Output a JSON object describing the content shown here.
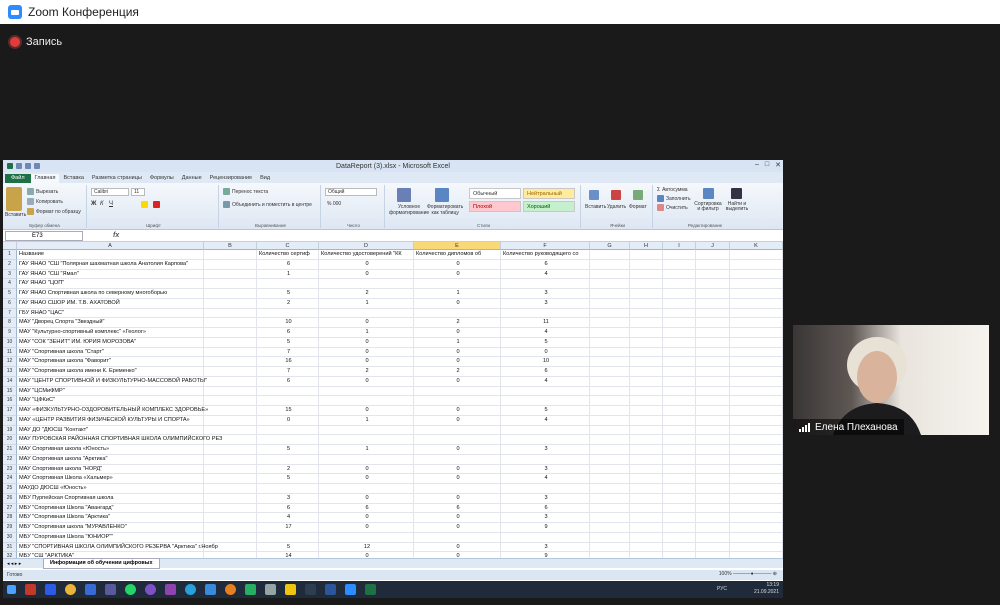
{
  "zoom": {
    "title": "Zoom Конференция",
    "recording": "Запись",
    "colors": {
      "recording": "#e23b3b",
      "brand": "#2D8CFF"
    }
  },
  "excel": {
    "title": "DataReport (3).xlsx - Microsoft Excel",
    "tabs": [
      "Файл",
      "Главная",
      "Вставка",
      "Разметка страницы",
      "Формулы",
      "Данные",
      "Рецензирование",
      "Вид"
    ],
    "ribbon": {
      "clipboard": {
        "paste": "Вставить",
        "cut": "Вырезать",
        "copy": "Копировать",
        "format_painter": "Формат по образцу",
        "caption": "Буфер обмена"
      },
      "font": {
        "name": "Calibri",
        "size": "11",
        "caption": "Шрифт"
      },
      "alignment": {
        "wrap": "Перенос текста",
        "merge": "Объединить и поместить в центре",
        "caption": "Выравнивание"
      },
      "number": {
        "format": "Общий",
        "caption": "Число"
      },
      "styles": {
        "conditional": "Условное форматирование",
        "as_table": "Форматировать как таблицу",
        "normal": "Обычный",
        "neutral": "Нейтральный",
        "bad": "Плохой",
        "good": "Хороший",
        "caption": "Стили"
      },
      "cells": {
        "insert": "Вставить",
        "delete": "Удалить",
        "format": "Формат",
        "caption": "Ячейки"
      },
      "editing": {
        "autosum": "Автосумма",
        "fill": "Заполнить",
        "clear": "Очистить",
        "sort": "Сортировка и фильтр",
        "find": "Найти и выделить",
        "caption": "Редактирование"
      }
    },
    "name_box": "E73",
    "fx": "fx",
    "columns": [
      "A",
      "B",
      "C",
      "D",
      "E",
      "F",
      "G",
      "H",
      "I",
      "J",
      "K"
    ],
    "rows": [
      {
        "n": "1",
        "a": "Название",
        "c": "Количество сертиф",
        "d": "Количество удостоверений \"КК",
        "e": "Количество дипломов об",
        "f": "Количество руководящего со"
      },
      {
        "n": "2",
        "a": "ГАУ ЯНАО \"СШ \"Полярная шахматная школа Анатолия Карпова\"",
        "c": "6",
        "d": "0",
        "e": "0",
        "f": "6"
      },
      {
        "n": "3",
        "a": "ГАУ ЯНАО \"СШ \"Ямал\"",
        "c": "1",
        "d": "0",
        "e": "0",
        "f": "4"
      },
      {
        "n": "4",
        "a": "ГАУ ЯНАО \"ЦОП\"",
        "c": "",
        "d": "",
        "e": "",
        "f": ""
      },
      {
        "n": "5",
        "a": "ГАУ ЯНАО Спортивная школа по северному многоборью",
        "c": "5",
        "d": "2",
        "e": "1",
        "f": "3"
      },
      {
        "n": "6",
        "a": "ГАУ ЯНАО СШОР ИМ. Т.В. АХАТОВОЙ",
        "c": "2",
        "d": "1",
        "e": "0",
        "f": "3"
      },
      {
        "n": "7",
        "a": "ГБУ ЯНАО \"ЦАС\"",
        "c": "",
        "d": "",
        "e": "",
        "f": ""
      },
      {
        "n": "8",
        "a": "МАУ \"Дворец Спорта \"Звездный\"",
        "c": "10",
        "d": "0",
        "e": "2",
        "f": "11"
      },
      {
        "n": "9",
        "a": "МАУ \"Культурно-спортивный комплекс\" «Геолог»",
        "c": "6",
        "d": "1",
        "e": "0",
        "f": "4"
      },
      {
        "n": "10",
        "a": "МАУ \"СОК \"ЗЕНИТ\" ИМ. ЮРИЯ МОРОЗОВА\"",
        "c": "5",
        "d": "0",
        "e": "1",
        "f": "5"
      },
      {
        "n": "11",
        "a": "МАУ \"Спортивная школа \"Старт\"",
        "c": "7",
        "d": "0",
        "e": "0",
        "f": "0"
      },
      {
        "n": "12",
        "a": "МАУ \"Спортивная школа \"Фаворит\"",
        "c": "16",
        "d": "0",
        "e": "0",
        "f": "10"
      },
      {
        "n": "13",
        "a": "МАУ \"Спортивная школа имени К. Еременко\"",
        "c": "7",
        "d": "2",
        "e": "2",
        "f": "6"
      },
      {
        "n": "14",
        "a": "МАУ \"ЦЕНТР СПОРТИВНОЙ И ФИЗКУЛЬТУРНО-МАССОВОЙ РАБОТЫ\"",
        "c": "6",
        "d": "0",
        "e": "0",
        "f": "4"
      },
      {
        "n": "15",
        "a": "МАУ \"ЦСМиФМР\"",
        "c": "",
        "d": "",
        "e": "",
        "f": ""
      },
      {
        "n": "16",
        "a": "МАУ \"ЦФКиС\"",
        "c": "",
        "d": "",
        "e": "",
        "f": ""
      },
      {
        "n": "17",
        "a": "МАУ «ФИЗКУЛЬТУРНО-ОЗДОРОВИТЕЛЬНЫЙ КОМПЛЕКС ЗДОРОВЬЕ»",
        "c": "15",
        "d": "0",
        "e": "0",
        "f": "5"
      },
      {
        "n": "18",
        "a": "МАУ «ЦЕНТР РАЗВИТИЯ ФИЗИЧЕСКОЙ КУЛЬТУРЫ И СПОРТА»",
        "c": "0",
        "d": "1",
        "e": "0",
        "f": "4"
      },
      {
        "n": "19",
        "a": "МАУ ДО \"ДЮСШ \"Контакт\"",
        "c": "",
        "d": "",
        "e": "",
        "f": ""
      },
      {
        "n": "20",
        "a": "МАУ ПУРОВСКАЯ РАЙОННАЯ СПОРТИВНАЯ ШКОЛА ОЛИМПИЙСКОГО РЕЗ",
        "c": "",
        "d": "",
        "e": "",
        "f": ""
      },
      {
        "n": "21",
        "a": "МАУ Спортивная школа «Юность»",
        "c": "5",
        "d": "1",
        "e": "0",
        "f": "3"
      },
      {
        "n": "22",
        "a": "МАУ Спортивная школа \"Арктика\"",
        "c": "",
        "d": "",
        "e": "",
        "f": ""
      },
      {
        "n": "23",
        "a": "МАУ Спортивная школа \"НОРД\"",
        "c": "2",
        "d": "0",
        "e": "0",
        "f": "3"
      },
      {
        "n": "24",
        "a": "МАУ Спортивная Школа «Хальмер»",
        "c": "5",
        "d": "0",
        "e": "0",
        "f": "4"
      },
      {
        "n": "25",
        "a": "МАУДО ДЮСШ «Юность»",
        "c": "",
        "d": "",
        "e": "",
        "f": ""
      },
      {
        "n": "26",
        "a": "МБУ Пурпейская Спортивная школа",
        "c": "3",
        "d": "0",
        "e": "0",
        "f": "3"
      },
      {
        "n": "27",
        "a": "МБУ \"Спортивная Школа \"Авангард\"",
        "c": "6",
        "d": "6",
        "e": "6",
        "f": "6"
      },
      {
        "n": "28",
        "a": "МБУ \"Спортивная Школа \"Арктика\"",
        "c": "4",
        "d": "0",
        "e": "0",
        "f": "3"
      },
      {
        "n": "29",
        "a": "МБУ \"Спортивная школа \"МУРАВЛЕНКО\"",
        "c": "17",
        "d": "0",
        "e": "0",
        "f": "9"
      },
      {
        "n": "30",
        "a": "МБУ \"Спортивная Школа \"ЮНИОР\"\"",
        "c": "",
        "d": "",
        "e": "",
        "f": ""
      },
      {
        "n": "31",
        "a": "МБУ \"СПОРТИВНАЯ ШКОЛА ОЛИМПИЙСКОГО РЕЗЕРВА \"Арктика\" г.Ноябр",
        "c": "5",
        "d": "12",
        "e": "0",
        "f": "3"
      },
      {
        "n": "32",
        "a": "МБУ \"СШ \"АРКТИКА\"",
        "c": "14",
        "d": "0",
        "e": "0",
        "f": "9"
      }
    ],
    "sheet_tab": "Информация об обучении цифровых",
    "status": "Готово",
    "zoom_level": "100%",
    "lang": "РУС",
    "clock": {
      "time": "13:19",
      "date": "21.09.2021"
    }
  },
  "participant": {
    "name": "Елена Плеханова"
  }
}
